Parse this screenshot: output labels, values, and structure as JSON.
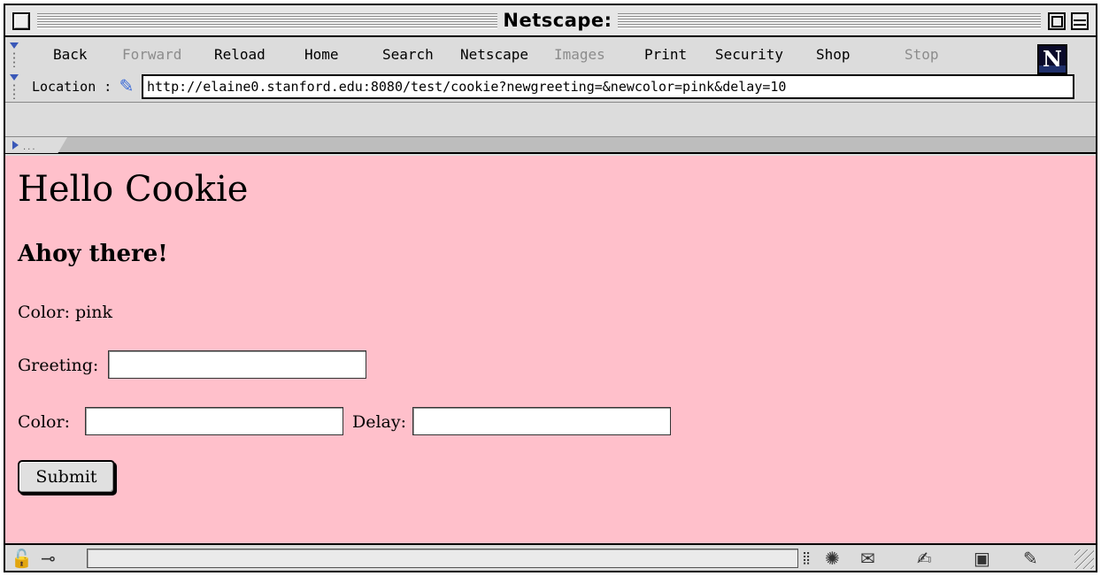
{
  "window": {
    "title": "Netscape:"
  },
  "toolbar": {
    "buttons": [
      {
        "label": "Back",
        "enabled": true
      },
      {
        "label": "Forward",
        "enabled": false
      },
      {
        "label": "Reload",
        "enabled": true
      },
      {
        "label": "Home",
        "enabled": true
      },
      {
        "label": "Search",
        "enabled": true
      },
      {
        "label": "Netscape",
        "enabled": true
      },
      {
        "label": "Images",
        "enabled": false
      },
      {
        "label": "Print",
        "enabled": true
      },
      {
        "label": "Security",
        "enabled": true
      },
      {
        "label": "Shop",
        "enabled": true
      },
      {
        "label": "Stop",
        "enabled": false
      }
    ],
    "logo": "N"
  },
  "location": {
    "label": "Location :",
    "url": "http://elaine0.stanford.edu:8080/test/cookie?newgreeting=&newcolor=pink&delay=10"
  },
  "page": {
    "background": "#ffc0cb",
    "heading": "Hello Cookie",
    "greeting": "Ahoy there!",
    "color_text": "Color: pink",
    "form": {
      "greeting_label": "Greeting:",
      "greeting_value": "",
      "color_label": "Color:",
      "color_value": "",
      "delay_label": "Delay:",
      "delay_value": "",
      "submit_label": "Submit"
    }
  },
  "statusbar": {
    "icons": [
      "lock-icon",
      "connection-icon",
      "online-icon",
      "navigator-icon",
      "mail-icon",
      "composer-icon",
      "address-book-icon",
      "resize-icon"
    ]
  }
}
